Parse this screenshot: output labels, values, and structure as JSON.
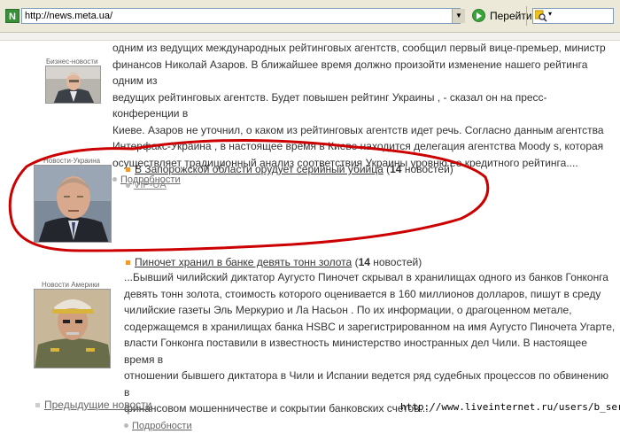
{
  "browser": {
    "address": "http://news.meta.ua/",
    "go_label": "Перейти"
  },
  "story1": {
    "category": "Бизнес-новости",
    "lines": [
      "одним из ведущих международных рейтинговых агентств, сообщил первый вице-премьер, министр",
      "финансов Николай Азаров. В ближайшее время должно произойти изменение нашего рейтинга одним из",
      "ведущих рейтинговых агентств. Будет повышен рейтинг Украины , - сказал он на пресс-конференции в",
      "Киеве. Азаров не уточнил, о каком из рейтинговых агентств идет речь. Согласно данным агентства",
      "Интерфакс-Украина , в настоящее время в Киеве находится делегация агентства Moody s, которая",
      "осуществляет традиционный анализ соответствия Украины уровню ее кредитного рейтинга...."
    ],
    "more": "Подробности"
  },
  "story2": {
    "category": "Новости-Украина",
    "headline": "В Запорожской области орудует серийный убийца",
    "count_open": "(",
    "count_num": "14",
    "count_rest": " новостей)",
    "source": "VIP-UA"
  },
  "story3": {
    "category": "Новости Америки",
    "headline": "Пиночет хранил в банке девять тонн золота",
    "count_open": "(",
    "count_num": "14",
    "count_rest": " новостей)",
    "lines": [
      "...Бывший чилийский диктатор Аугусто Пиночет скрывал в хранилищах одного из банков Гонконга",
      "девять тонн золота, стоимость которого оценивается в 160 миллионов долларов, пишут в среду",
      "чилийские газеты Эль Меркурио и Ла Насьон . По их информации, о драгоценном метале,",
      "содержащемся в хранилищах банка HSBC и зарегистрированном на имя Аугусто Пиночета Угарте,",
      "власти Гонконга поставили в известность министерство иностранных дел Чили. В настоящее время в",
      "отношении бывшего диктатора в Чили и Испании ведется ряд судебных процессов по обвинению в",
      "финансовом мошенничестве и сокрытии банковских счетов...."
    ],
    "more": "Подробности"
  },
  "footer": {
    "prev_label": "Предыдущие новости",
    "watermark_url": "http://www.liveinternet.ru/users/b_serj/"
  },
  "colors": {
    "bullet": "#f29a2e",
    "highlight_oval": "#cc0000"
  }
}
